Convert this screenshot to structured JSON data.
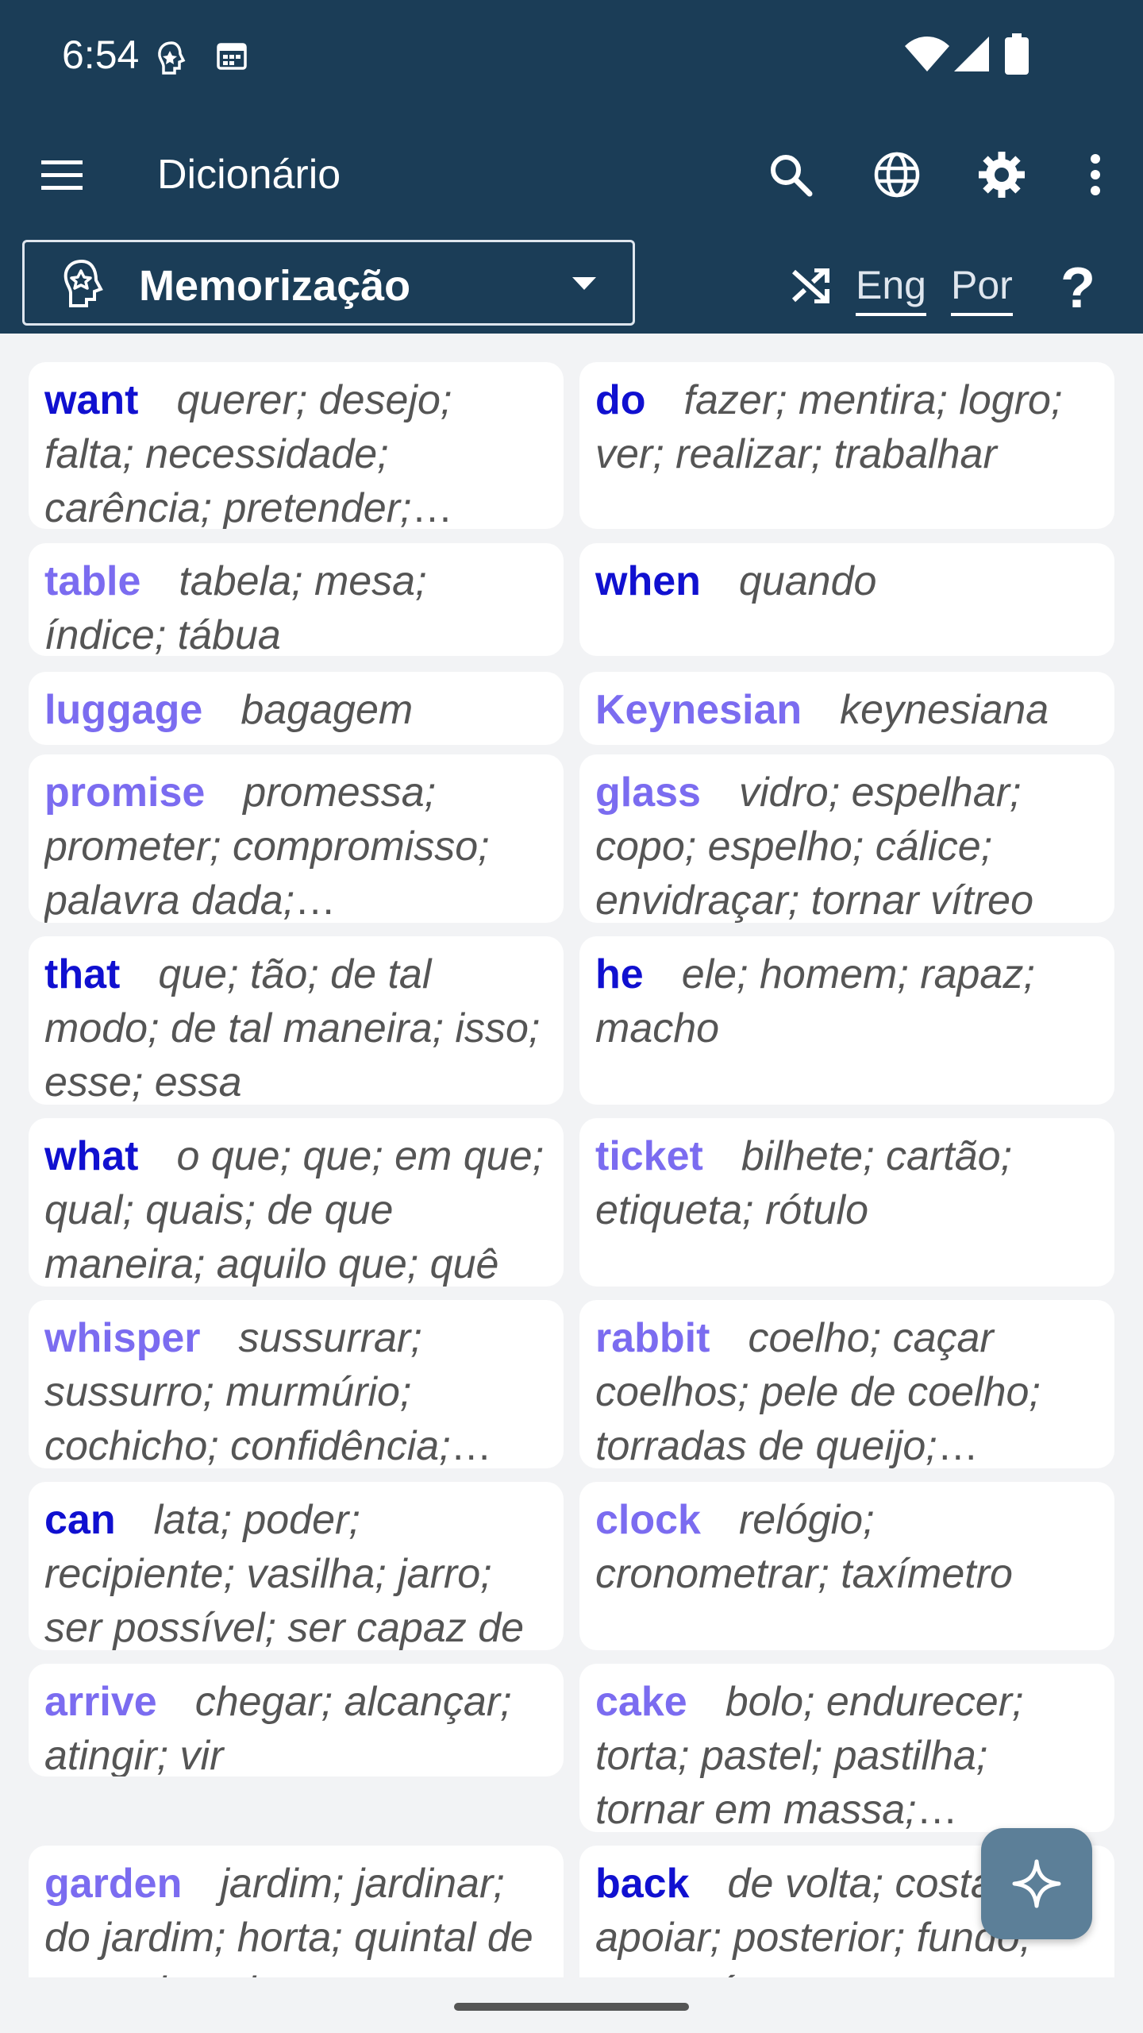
{
  "status": {
    "time": "6:54"
  },
  "appbar": {
    "title": "Dicionário"
  },
  "toolbar": {
    "mode": "Memorização",
    "lang_from": "Eng",
    "lang_to": "Por",
    "help": "?"
  },
  "colors": {
    "bar": "#1b3d57",
    "word_dark": "#1010d0",
    "word_light": "#7b6cf0",
    "fab": "#5c7f98"
  },
  "cards": [
    {
      "word": "want",
      "defs": "querer; desejo; falta; necessidade; carência; pretender; precisar",
      "tone": "dark"
    },
    {
      "word": "do",
      "defs": "fazer; mentira; logro; ver; realizar; trabalhar",
      "tone": "dark"
    },
    {
      "word": "table",
      "defs": "tabela; mesa; índice; tábua",
      "tone": "light"
    },
    {
      "word": "when",
      "defs": "quando",
      "tone": "dark"
    },
    {
      "word": "luggage",
      "defs": "bagagem",
      "tone": "light"
    },
    {
      "word": "Keynesian",
      "defs": "keynesiana",
      "tone": "light"
    },
    {
      "word": "promise",
      "defs": "promessa; prometer; compromisso; palavra dada; prometimento",
      "tone": "light"
    },
    {
      "word": "glass",
      "defs": "vidro; espelhar; copo; espelho; cálice; envidraçar; tornar vítreo",
      "tone": "light"
    },
    {
      "word": "that",
      "defs": "que; tão; de tal modo; de tal maneira; isso; esse; essa",
      "tone": "dark"
    },
    {
      "word": "he",
      "defs": "ele; homem; rapaz; macho",
      "tone": "dark"
    },
    {
      "word": "what",
      "defs": "o que; que; em que; qual; quais; de que maneira; aquilo que; quê",
      "tone": "dark"
    },
    {
      "word": "ticket",
      "defs": "bilhete; cartão; etiqueta; rótulo",
      "tone": "light"
    },
    {
      "word": "whisper",
      "defs": "sussurrar; sussurro; murmúrio; cochicho; confidência; segredo",
      "tone": "light"
    },
    {
      "word": "rabbit",
      "defs": "coelho; caçar coelhos; pele de coelho; torradas de queijo; indivíduo",
      "tone": "light"
    },
    {
      "word": "can",
      "defs": "lata; poder; recipiente; vasilha; jarro; ser possível; ser capaz de",
      "tone": "dark"
    },
    {
      "word": "clock",
      "defs": "relógio; cronometrar; taxímetro",
      "tone": "light"
    },
    {
      "word": "arrive",
      "defs": "chegar; alcançar; atingir; vir",
      "tone": "light"
    },
    {
      "word": "cake",
      "defs": "bolo; endurecer; torta; pastel; pastilha; tornar em massa; solidificar",
      "tone": "light"
    },
    {
      "word": "garden",
      "defs": "jardim; jardinar; do jardim; horta; quintal de uma vivenda",
      "tone": "light"
    },
    {
      "word": "back",
      "defs": "de volta; costas; apoiar; posterior; fundo; para trás",
      "tone": "dark"
    }
  ]
}
